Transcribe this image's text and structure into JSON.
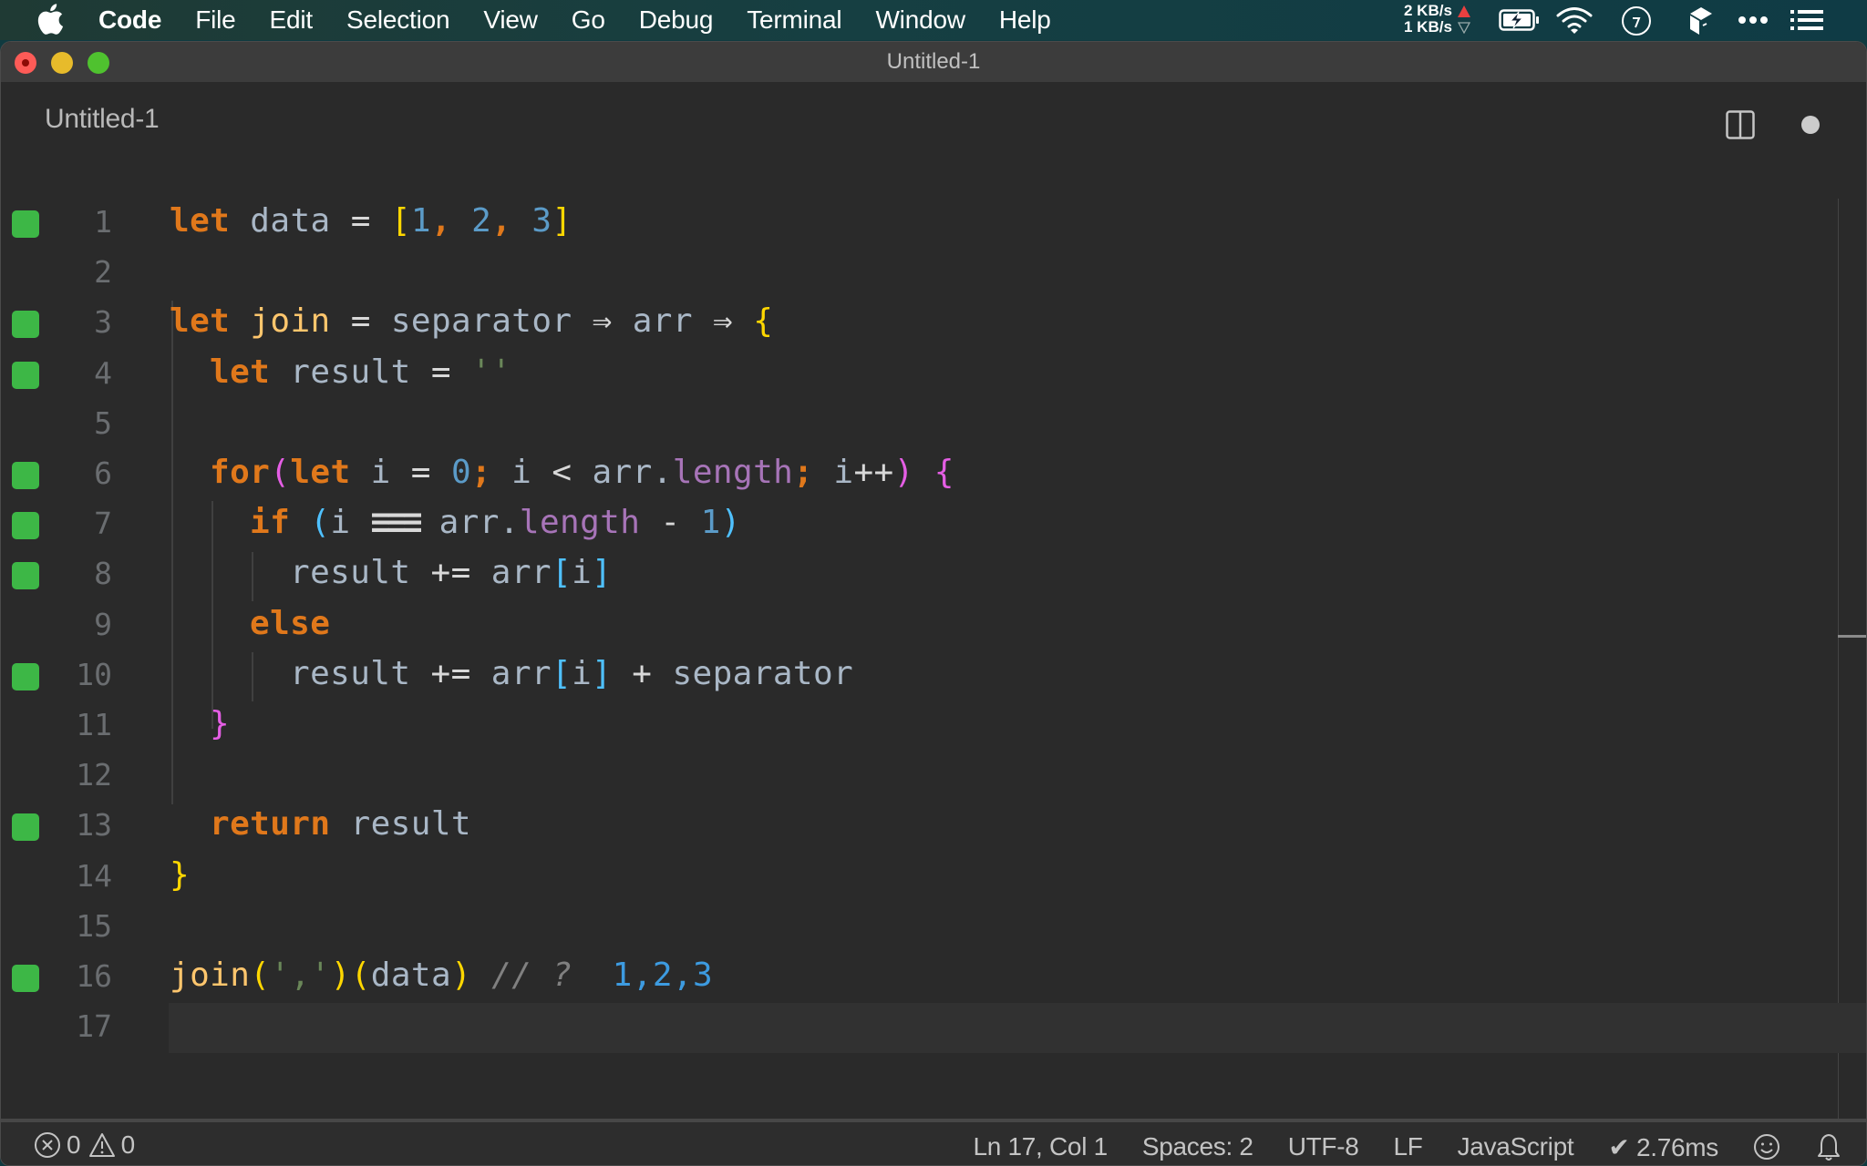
{
  "menubar": {
    "apple_icon": "apple-logo-icon",
    "items": [
      "Code",
      "File",
      "Edit",
      "Selection",
      "View",
      "Go",
      "Debug",
      "Terminal",
      "Window",
      "Help"
    ],
    "network": {
      "upload": "2 KB/s",
      "download": "1 KB/s"
    },
    "status_icons": [
      "battery-charging-icon",
      "wifi-icon",
      "clock-icon",
      "package-icon",
      "more-icon",
      "list-icon"
    ]
  },
  "window": {
    "title": "Untitled-1",
    "tab": {
      "label": "Untitled-1",
      "dirty": true
    },
    "actions": [
      "split-editor-icon"
    ]
  },
  "editor": {
    "current_line": 17,
    "lines": [
      {
        "n": "1",
        "marker": true,
        "indent": 0,
        "tokens": [
          [
            "kw",
            "let"
          ],
          [
            "var",
            " data "
          ],
          [
            "op",
            "="
          ],
          [
            "var",
            " "
          ],
          [
            "b1",
            "["
          ],
          [
            "num",
            "1"
          ],
          [
            "kw",
            ", "
          ],
          [
            "num",
            "2"
          ],
          [
            "kw",
            ", "
          ],
          [
            "num",
            "3"
          ],
          [
            "b1",
            "]"
          ]
        ]
      },
      {
        "n": "2",
        "marker": false,
        "indent": 0,
        "tokens": []
      },
      {
        "n": "3",
        "marker": true,
        "indent": 0,
        "tokens": [
          [
            "kw",
            "let"
          ],
          [
            "var",
            " "
          ],
          [
            "fn",
            "join"
          ],
          [
            "var",
            " "
          ],
          [
            "op",
            "="
          ],
          [
            "var",
            " separator "
          ],
          [
            "op",
            "⇒"
          ],
          [
            "var",
            " arr "
          ],
          [
            "op",
            "⇒"
          ],
          [
            "var",
            " "
          ],
          [
            "b1",
            "{"
          ]
        ]
      },
      {
        "n": "4",
        "marker": true,
        "indent": 1,
        "tokens": [
          [
            "kw",
            "let"
          ],
          [
            "var",
            " result "
          ],
          [
            "op",
            "="
          ],
          [
            "var",
            " "
          ],
          [
            "str",
            "''"
          ]
        ]
      },
      {
        "n": "5",
        "marker": false,
        "indent": 0,
        "tokens": []
      },
      {
        "n": "6",
        "marker": true,
        "indent": 1,
        "tokens": [
          [
            "kw",
            "for"
          ],
          [
            "b2",
            "("
          ],
          [
            "kw",
            "let"
          ],
          [
            "var",
            " i "
          ],
          [
            "op",
            "="
          ],
          [
            "var",
            " "
          ],
          [
            "num",
            "0"
          ],
          [
            "kw",
            ";"
          ],
          [
            "var",
            " i "
          ],
          [
            "op",
            "<"
          ],
          [
            "var",
            " arr."
          ],
          [
            "prop",
            "length"
          ],
          [
            "kw",
            ";"
          ],
          [
            "var",
            " i"
          ],
          [
            "op",
            "++"
          ],
          [
            "b2",
            ")"
          ],
          [
            "var",
            " "
          ],
          [
            "b2",
            "{"
          ]
        ]
      },
      {
        "n": "7",
        "marker": true,
        "indent": 2,
        "tokens": [
          [
            "kw",
            "if"
          ],
          [
            "var",
            " "
          ],
          [
            "b3",
            "("
          ],
          [
            "var",
            "i "
          ],
          [
            "strict",
            "≡≡≡"
          ],
          [
            "var",
            " arr."
          ],
          [
            "prop",
            "length"
          ],
          [
            "var",
            " "
          ],
          [
            "op",
            "-"
          ],
          [
            "var",
            " "
          ],
          [
            "num",
            "1"
          ],
          [
            "b3",
            ")"
          ]
        ]
      },
      {
        "n": "8",
        "marker": true,
        "indent": 3,
        "tokens": [
          [
            "var",
            "result "
          ],
          [
            "op",
            "+="
          ],
          [
            "var",
            " arr"
          ],
          [
            "b3",
            "["
          ],
          [
            "var",
            "i"
          ],
          [
            "b3",
            "]"
          ]
        ]
      },
      {
        "n": "9",
        "marker": false,
        "indent": 2,
        "tokens": [
          [
            "kw",
            "else"
          ]
        ]
      },
      {
        "n": "10",
        "marker": true,
        "indent": 3,
        "tokens": [
          [
            "var",
            "result "
          ],
          [
            "op",
            "+="
          ],
          [
            "var",
            " arr"
          ],
          [
            "b3",
            "["
          ],
          [
            "var",
            "i"
          ],
          [
            "b3",
            "]"
          ],
          [
            "var",
            " "
          ],
          [
            "op",
            "+"
          ],
          [
            "var",
            " separator"
          ]
        ]
      },
      {
        "n": "11",
        "marker": false,
        "indent": 1,
        "tokens": [
          [
            "b2",
            "}"
          ]
        ]
      },
      {
        "n": "12",
        "marker": false,
        "indent": 0,
        "tokens": []
      },
      {
        "n": "13",
        "marker": true,
        "indent": 1,
        "tokens": [
          [
            "kw",
            "return"
          ],
          [
            "var",
            " result"
          ]
        ]
      },
      {
        "n": "14",
        "marker": false,
        "indent": 0,
        "tokens": [
          [
            "b1",
            "}"
          ]
        ]
      },
      {
        "n": "15",
        "marker": false,
        "indent": 0,
        "tokens": []
      },
      {
        "n": "16",
        "marker": true,
        "indent": 0,
        "tokens": [
          [
            "fn",
            "join"
          ],
          [
            "b1",
            "("
          ],
          [
            "str",
            "','"
          ],
          [
            "b1",
            ")"
          ],
          [
            "b1",
            "("
          ],
          [
            "var",
            "data"
          ],
          [
            "b1",
            ")"
          ],
          [
            "var",
            " "
          ],
          [
            "cmt",
            "// ?"
          ],
          [
            "var",
            "  "
          ],
          [
            "result",
            "1,2,3"
          ]
        ]
      },
      {
        "n": "17",
        "marker": false,
        "indent": 0,
        "tokens": []
      }
    ],
    "colors": {
      "keyword": "#e0781b",
      "function": "#ffc66d",
      "variable": "#a9b7c6",
      "number": "#5b9bc8",
      "string": "#6a8759",
      "property": "#a774b8",
      "bracket_level1": "#ffd700",
      "bracket_level2": "#e55ee5",
      "bracket_level3": "#4fc1ff",
      "comment": "#808080",
      "inline_result": "#3d9be0",
      "coverage_marker": "#3db746"
    }
  },
  "statusbar": {
    "errors": "0",
    "warnings": "0",
    "position": "Ln 17, Col 1",
    "indentation": "Spaces: 2",
    "encoding": "UTF-8",
    "eol": "LF",
    "language": "JavaScript",
    "timing": "✔ 2.76ms",
    "feedback_icon": "smiley-icon",
    "notifications_icon": "bell-icon"
  }
}
